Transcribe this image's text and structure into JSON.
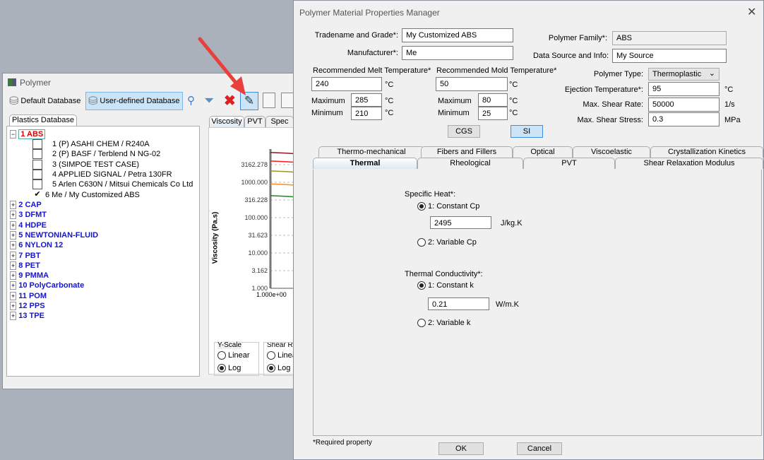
{
  "polymer_window": {
    "title": "Polymer",
    "toolbar": {
      "default_db": "Default Database",
      "user_db": "User-defined Database"
    },
    "tree_tab": "Plastics Database",
    "tree": {
      "expanded": {
        "label": "1  ABS",
        "children": [
          "1  (P)  ASAHI CHEM / R240A",
          "2  (P)  BASF / Terblend N NG-02",
          "3  (SIMPOE TEST CASE)",
          "4  APPLIED SIGNAL / Petra 130FR",
          "5  Arlen C630N / Mitsui Chemicals Co Ltd",
          "6  Me / My Customized ABS"
        ],
        "checked_index": 5
      },
      "groups": [
        "2  CAP",
        "3  DFMT",
        "4  HDPE",
        "5  NEWTONIAN-FLUID",
        "6  NYLON 12",
        "7  PBT",
        "8  PET",
        "9  PMMA",
        "10  PolyCarbonate",
        "11  POM",
        "12  PPS",
        "13  TPE"
      ]
    },
    "chart_tabs": [
      "Viscosity",
      "PVT",
      "Spec"
    ],
    "chart": {
      "ylabel": "Viscosity (Pa.s)",
      "y_ticks": [
        "3162.278",
        "1000.000",
        "316.228",
        "100.000",
        "31.623",
        "10.000",
        "3.162",
        "1.000"
      ],
      "x_tick": "1.000e+00",
      "y_scale": "log",
      "series_colors": [
        "#8b1a1a",
        "#ff1a1a",
        "#9a9a1a",
        "#ff8c1a",
        "#1a8a1a"
      ],
      "series_start_values": [
        7000,
        4000,
        2100,
        900,
        420
      ]
    },
    "yscale_group": {
      "title": "Y-Scale",
      "options": [
        "Linear",
        "Log"
      ],
      "selected": "Log"
    },
    "shear_group": {
      "title": "Shear Ra",
      "options": [
        "Linea",
        "Log"
      ],
      "selected": "Log"
    }
  },
  "dialog": {
    "title": "Polymer Material Properties Manager",
    "tradename_label": "Tradename and Grade*:",
    "tradename": "My Customized ABS",
    "manufacturer_label": "Manufacturer*:",
    "manufacturer": "Me",
    "family_label": "Polymer Family*:",
    "family": "ABS",
    "source_label": "Data Source and Info:",
    "source": "My Source",
    "melt": {
      "label": "Recommended Melt Temperature*",
      "value": "240",
      "max": "285",
      "min": "210"
    },
    "mold": {
      "label": "Recommended Mold Temperature*",
      "value": "50",
      "max": "80",
      "min": "25"
    },
    "max_label": "Maximum",
    "min_label": "Minimum",
    "degc": "°C",
    "type_label": "Polymer Type:",
    "type": "Thermoplastic",
    "ejection_label": "Ejection Temperature*:",
    "ejection": "95",
    "shear_rate_label": "Max. Shear Rate:",
    "shear_rate": "50000",
    "shear_rate_unit": "1/s",
    "shear_stress_label": "Max. Shear Stress:",
    "shear_stress": "0.3",
    "shear_stress_unit": "MPa",
    "cgs": "CGS",
    "si": "SI",
    "tabs_row1": [
      "Thermo-mechanical",
      "Fibers and Fillers",
      "Optical",
      "Viscoelastic",
      "Crystallization Kinetics"
    ],
    "tabs_row2": [
      "Thermal",
      "Rheological",
      "PVT",
      "Shear Relaxation Modulus"
    ],
    "active_tab": "Thermal",
    "thermal": {
      "cp_label": "Specific Heat*:",
      "cp_opt1": "1: Constant Cp",
      "cp_value": "2495",
      "cp_unit": "J/kg.K",
      "cp_opt2": "2: Variable Cp",
      "k_label": "Thermal Conductivity*:",
      "k_opt1": "1: Constant k",
      "k_value": "0.21",
      "k_unit": "W/m.K",
      "k_opt2": "2: Variable k"
    },
    "required_note": "*Required property",
    "ok": "OK",
    "cancel": "Cancel"
  },
  "colors": {
    "accent": "#cce4f7",
    "group_text": "#1515d0",
    "selected_text": "#e00000",
    "arrow": "#e8413c"
  }
}
